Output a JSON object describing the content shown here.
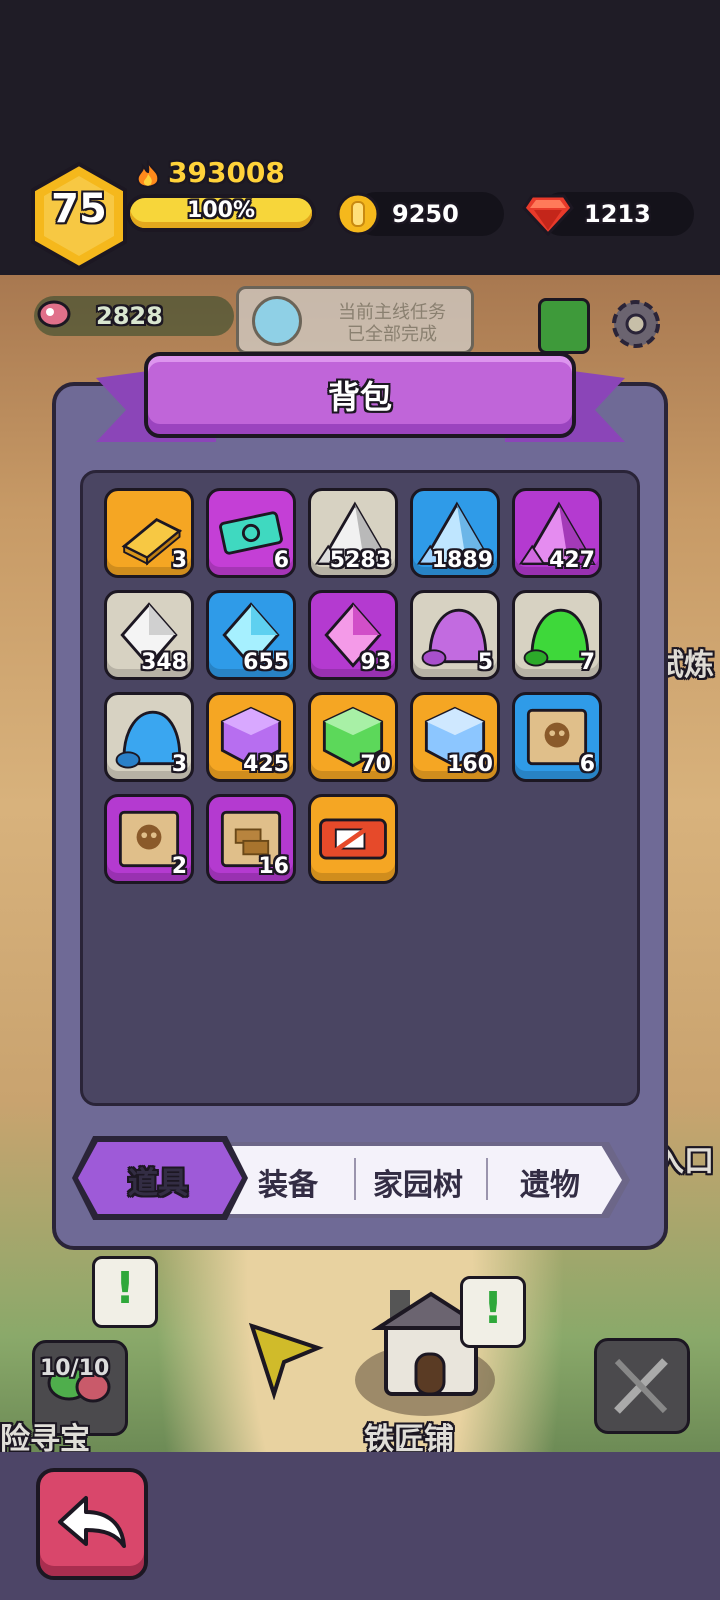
{
  "player": {
    "level": "75",
    "power": "393008",
    "exp_percent_label": "100%",
    "exp_fraction": 1.0
  },
  "currency": {
    "gold": "9250",
    "gems": "1213"
  },
  "background": {
    "food": "2828",
    "quest_line1": "当前主线任务",
    "quest_line2": "已全部完成",
    "side_text_1": "试炼",
    "side_text_2": "入口",
    "slime_count": "10/10",
    "left_label": "险寻宝",
    "smith_label": "铁匠铺"
  },
  "panel": {
    "title": "背包"
  },
  "items": [
    {
      "name": "gold-bar",
      "count": "3",
      "bg": "#f5a623"
    },
    {
      "name": "ticket",
      "count": "6",
      "bg": "#c43fd6"
    },
    {
      "name": "white-ore",
      "count": "5283",
      "bg": "#d7d2c2"
    },
    {
      "name": "blue-ore",
      "count": "1889",
      "bg": "#2f9be8"
    },
    {
      "name": "purple-ore",
      "count": "427",
      "bg": "#b43ad0"
    },
    {
      "name": "white-crystal",
      "count": "348",
      "bg": "#d7d2c2"
    },
    {
      "name": "blue-crystal",
      "count": "655",
      "bg": "#2f9be8"
    },
    {
      "name": "purple-crystal",
      "count": "93",
      "bg": "#b43ad0"
    },
    {
      "name": "purple-slime",
      "count": "5",
      "bg": "#d7d2c2"
    },
    {
      "name": "green-slime",
      "count": "7",
      "bg": "#d7d2c2"
    },
    {
      "name": "blue-slime",
      "count": "3",
      "bg": "#d7d2c2"
    },
    {
      "name": "purple-cube",
      "count": "425",
      "bg": "#f5a623"
    },
    {
      "name": "green-cube",
      "count": "70",
      "bg": "#f5a623"
    },
    {
      "name": "blue-cube",
      "count": "160",
      "bg": "#f5a623"
    },
    {
      "name": "skull-map-blue",
      "count": "6",
      "bg": "#2f9be8"
    },
    {
      "name": "skull-map-purple",
      "count": "2",
      "bg": "#b43ad0"
    },
    {
      "name": "gold-map-purple",
      "count": "16",
      "bg": "#b43ad0"
    },
    {
      "name": "no-ads-ticket",
      "count": "",
      "bg": "#f5a623"
    }
  ],
  "tabs": [
    {
      "label": "道具",
      "active": true
    },
    {
      "label": "装备",
      "active": false
    },
    {
      "label": "家园树",
      "active": false
    },
    {
      "label": "遗物",
      "active": false
    }
  ]
}
